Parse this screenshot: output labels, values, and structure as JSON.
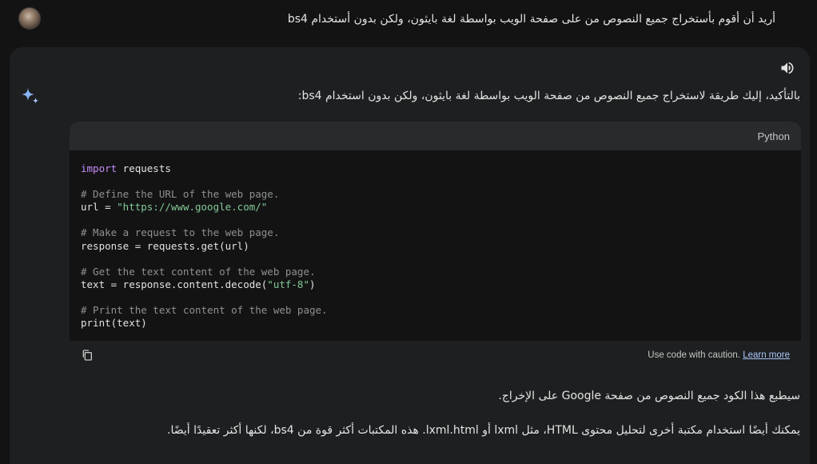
{
  "user_prompt": "أريد أن أقوم بأستخراج جميع النصوص من على صفحة الويب بواسطة لغة بايثون، ولكن بدون أستخدام bs4",
  "response": {
    "intro": "بالتأكيد، إليك طريقة لاستخراج جميع النصوص من صفحة الويب بواسطة لغة بايثون، ولكن بدون استخدام bs4:",
    "code_block": {
      "language": "Python",
      "lines": [
        [
          {
            "t": "import",
            "c": "kw"
          },
          {
            "t": " requests",
            "c": ""
          }
        ],
        [],
        [
          {
            "t": "# Define the URL of the web page.",
            "c": "cm"
          }
        ],
        [
          {
            "t": "url = ",
            "c": ""
          },
          {
            "t": "\"https://www.google.com/\"",
            "c": "st"
          }
        ],
        [],
        [
          {
            "t": "# Make a request to the web page.",
            "c": "cm"
          }
        ],
        [
          {
            "t": "response = requests.get(url)",
            "c": ""
          }
        ],
        [],
        [
          {
            "t": "# Get the text content of the web page.",
            "c": "cm"
          }
        ],
        [
          {
            "t": "text = response.content.decode(",
            "c": ""
          },
          {
            "t": "\"utf-8\"",
            "c": "st"
          },
          {
            "t": ")",
            "c": ""
          }
        ],
        [],
        [
          {
            "t": "# Print the text content of the web page.",
            "c": "cm"
          }
        ],
        [
          {
            "t": "print(text)",
            "c": ""
          }
        ]
      ],
      "caution_text": "Use code with caution.",
      "learn_more": "Learn more"
    },
    "paragraph_1": "سيطبع هذا الكود جميع النصوص من صفحة Google على الإخراج.",
    "paragraph_2": "يمكنك أيضًا استخدام مكتبة أخرى لتحليل محتوى HTML، مثل lxml أو lxml.html. هذه المكتبات أكثر قوة من bs4، لكنها أكثر تعقيدًا أيضًا."
  },
  "icons": {
    "speaker": "volume-icon",
    "assistant": "sparkle-icon",
    "copy": "copy-icon",
    "avatar": "user-avatar"
  },
  "colors": {
    "background": "#131314",
    "response_surface": "#1e1f20",
    "keyword": "#c58af9",
    "comment": "#8e918f",
    "string": "#81c995",
    "link": "#a8c7fa",
    "sparkle": "#8ab4f8"
  }
}
